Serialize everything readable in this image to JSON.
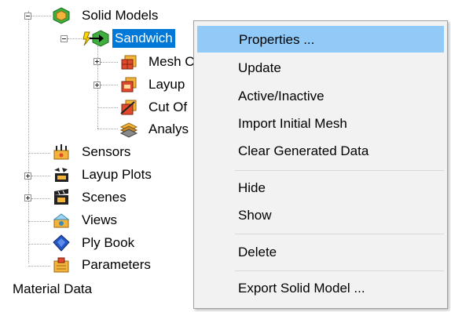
{
  "tree": {
    "items": [
      {
        "label": "Solid Models",
        "icon": "solid-models-icon"
      },
      {
        "label": "Sandwich",
        "icon": "sandwich-solid-model-icon"
      },
      {
        "label": "Mesh C",
        "icon": "mesh-icon"
      },
      {
        "label": "Layup",
        "icon": "layup-icon"
      },
      {
        "label": "Cut Of",
        "icon": "cut-off-icon"
      },
      {
        "label": "Analys",
        "icon": "analysis-icon"
      },
      {
        "label": "Sensors",
        "icon": "sensors-icon"
      },
      {
        "label": "Layup Plots",
        "icon": "layup-plots-icon"
      },
      {
        "label": "Scenes",
        "icon": "scenes-icon"
      },
      {
        "label": "Views",
        "icon": "views-icon"
      },
      {
        "label": "Ply Book",
        "icon": "ply-book-icon"
      },
      {
        "label": "Parameters",
        "icon": "parameters-icon"
      }
    ],
    "root_label": "Material Data"
  },
  "context_menu": {
    "items": [
      {
        "label": "Properties ..."
      },
      {
        "label": "Update"
      },
      {
        "label": "Active/Inactive"
      },
      {
        "label": "Import Initial Mesh"
      },
      {
        "label": "Clear Generated Data"
      },
      {
        "label": "Hide"
      },
      {
        "label": "Show"
      },
      {
        "label": "Delete"
      },
      {
        "label": "Export Solid Model ..."
      }
    ],
    "highlighted": "Properties ..."
  },
  "colors": {
    "selection": "#0078d7",
    "menu_highlight": "#91c9f7",
    "menu_background": "#f2f2f2"
  }
}
